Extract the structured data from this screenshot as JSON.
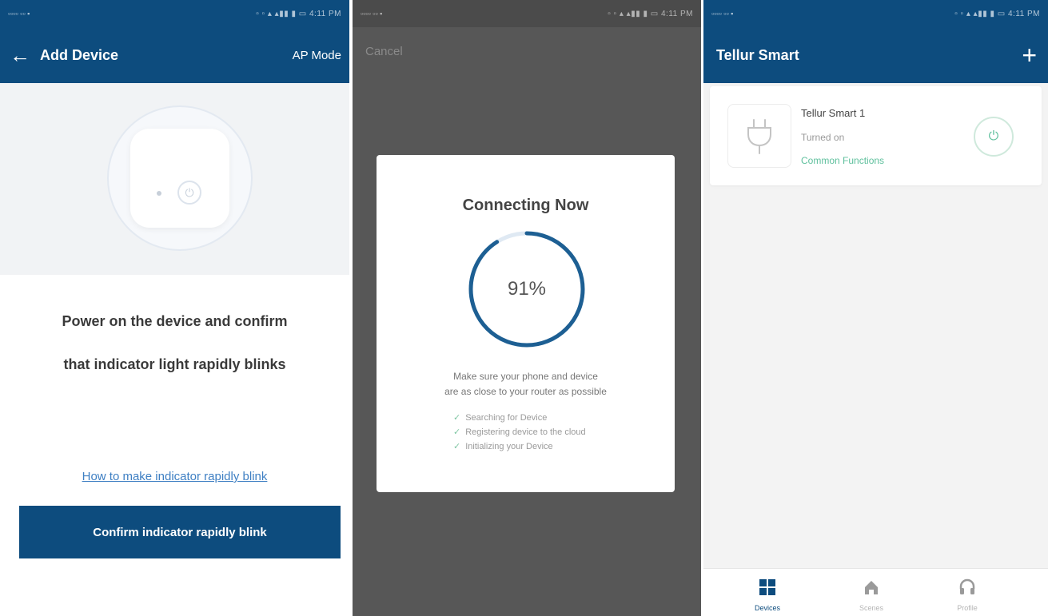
{
  "status_bar": {
    "left": "▫▫▫▫ ▫▫ ▪",
    "right": "▫ ▫  ▴ ▴▮▮ ▮ ▭ 4:11 PM"
  },
  "add_device": {
    "title": "Add Device",
    "mode": "AP Mode",
    "instruction_line1": "Power on the device and confirm",
    "instruction_line2": "that indicator light rapidly blinks",
    "help_link": "How to make indicator rapidly blink",
    "confirm_button": "Confirm indicator rapidly blink"
  },
  "connecting": {
    "cancel": "Cancel",
    "title": "Connecting Now",
    "progress": 0.91,
    "progress_label": "91%",
    "tip_line1": "Make sure your phone and device",
    "tip_line2": "are as close to your router as possible",
    "steps": [
      "Searching for Device",
      "Registering device to the cloud",
      "Initializing your Device"
    ],
    "accent_color": "#1d5f93"
  },
  "home": {
    "title": "Tellur Smart",
    "device": {
      "name": "Tellur Smart 1",
      "state": "Turned on",
      "functions_link": "Common Functions",
      "icon": "plug-icon"
    },
    "tabs": [
      {
        "label": "Devices",
        "icon": "grid-icon",
        "active": true
      },
      {
        "label": "Scenes",
        "icon": "home-icon",
        "active": false
      },
      {
        "label": "Profile",
        "icon": "headset-icon",
        "active": false
      }
    ]
  },
  "colors": {
    "brand": "#0d4c7e",
    "green": "#5fc09d",
    "link": "#3e7fc3"
  }
}
